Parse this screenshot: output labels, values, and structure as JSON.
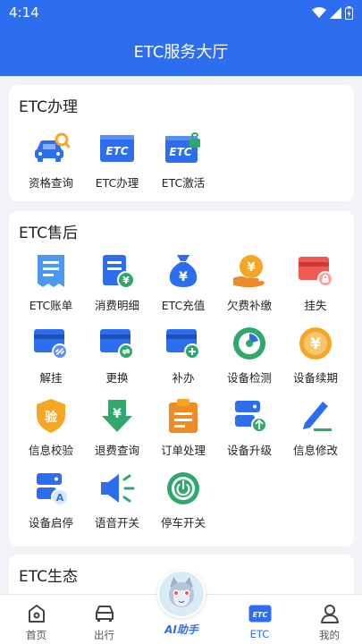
{
  "status_bar": {
    "time": "4:14"
  },
  "header": {
    "title": "ETC服务大厅"
  },
  "section_handle": {
    "title": "ETC办理",
    "items": [
      {
        "label": "资格查询",
        "icon": "car-search-icon"
      },
      {
        "label": "ETC办理",
        "icon": "etc-card-icon"
      },
      {
        "label": "ETC激活",
        "icon": "etc-activate-icon"
      }
    ]
  },
  "section_after": {
    "title": "ETC售后",
    "items": [
      {
        "label": "ETC账单",
        "icon": "bill-icon"
      },
      {
        "label": "消费明细",
        "icon": "consumption-detail-icon"
      },
      {
        "label": "ETC充值",
        "icon": "money-bag-icon"
      },
      {
        "label": "欠费补缴",
        "icon": "arrears-payment-icon"
      },
      {
        "label": "挂失",
        "icon": "report-loss-icon"
      },
      {
        "label": "解挂",
        "icon": "unlink-card-icon"
      },
      {
        "label": "更换",
        "icon": "replace-card-icon"
      },
      {
        "label": "补办",
        "icon": "reissue-card-icon"
      },
      {
        "label": "设备检测",
        "icon": "device-check-icon"
      },
      {
        "label": "设备续期",
        "icon": "device-renew-icon"
      },
      {
        "label": "信息校验",
        "icon": "verify-shield-icon"
      },
      {
        "label": "退费查询",
        "icon": "refund-query-icon"
      },
      {
        "label": "订单处理",
        "icon": "order-clipboard-icon"
      },
      {
        "label": "设备升级",
        "icon": "device-upgrade-icon"
      },
      {
        "label": "信息修改",
        "icon": "edit-pen-icon"
      },
      {
        "label": "设备启停",
        "icon": "device-toggle-icon"
      },
      {
        "label": "语音开关",
        "icon": "speaker-icon"
      },
      {
        "label": "停车开关",
        "icon": "power-icon"
      }
    ]
  },
  "section_eco": {
    "title": "ETC生态"
  },
  "tabbar": {
    "tabs": [
      {
        "label": "首页",
        "icon": "home-icon"
      },
      {
        "label": "出行",
        "icon": "car-icon"
      },
      {
        "label": "AI助手",
        "icon": "ai-assistant-icon"
      },
      {
        "label": "ETC",
        "icon": "etc-tab-icon"
      },
      {
        "label": "我的",
        "icon": "profile-icon"
      }
    ],
    "active": "ETC"
  },
  "colors": {
    "primary": "#2d6ef0",
    "orange": "#f5a623",
    "green": "#2ea86b",
    "red": "#f05a52"
  }
}
